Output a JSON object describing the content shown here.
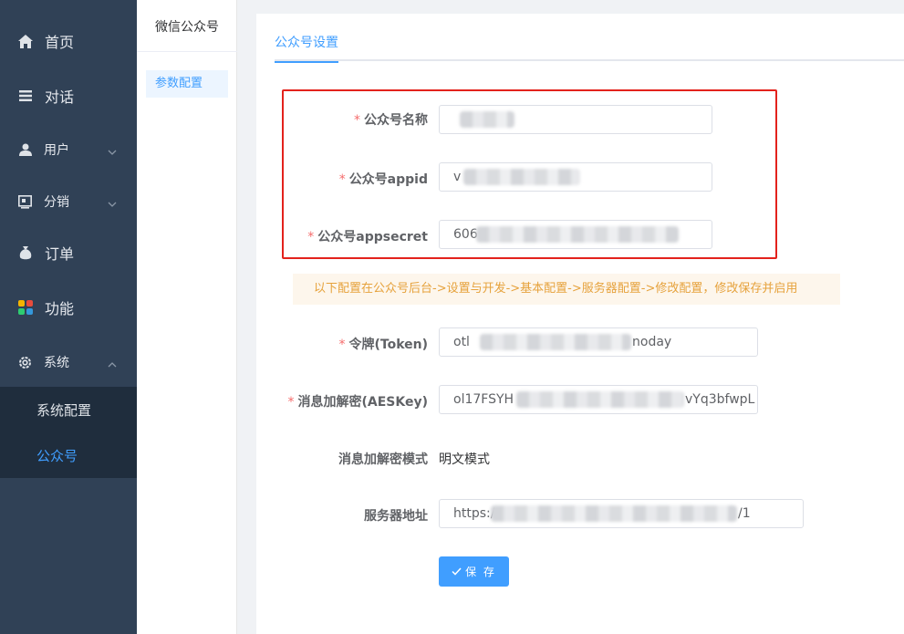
{
  "sidebar": {
    "items": [
      {
        "label": "首页",
        "icon": "home-icon"
      },
      {
        "label": "对话",
        "icon": "list-icon"
      },
      {
        "label": "用户",
        "icon": "user-icon"
      },
      {
        "label": "分销",
        "icon": "distribution-icon"
      },
      {
        "label": "订单",
        "icon": "order-bag-icon"
      },
      {
        "label": "功能",
        "icon": "grid-icon"
      },
      {
        "label": "系统",
        "icon": "gear-icon"
      }
    ],
    "submenu": [
      {
        "label": "系统配置"
      },
      {
        "label": "公众号"
      }
    ]
  },
  "secondary": {
    "title": "微信公众号",
    "item": "参数配置"
  },
  "tabs": [
    {
      "label": "公众号设置"
    }
  ],
  "form": {
    "name_label": "公众号名称",
    "name_value": "",
    "appid_label": "公众号appid",
    "appid_value": "v",
    "appsecret_label": "公众号appsecret",
    "appsecret_value": "606",
    "notice": "以下配置在公众号后台->设置与开发->基本配置->服务器配置->修改配置，修改保存并启用",
    "token_label": "令牌(Token)",
    "token_prefix": "otl",
    "token_suffix": "noday",
    "aes_label": "消息加解密(AESKey)",
    "aes_prefix": "ol17FSYH",
    "aes_suffix": "vYq3bfwpL",
    "mode_label": "消息加解密模式",
    "mode_value": "明文模式",
    "server_label": "服务器地址",
    "server_prefix": "https:/",
    "server_suffix": "/1",
    "save_label": "保 存"
  },
  "colors": {
    "sidebar_bg": "#304156",
    "submenu_bg": "#1f2d3d",
    "primary": "#409eff",
    "highlight_box": "#e3221c",
    "notice_bg": "#fdf6ec",
    "notice_text": "#e6a23c"
  }
}
